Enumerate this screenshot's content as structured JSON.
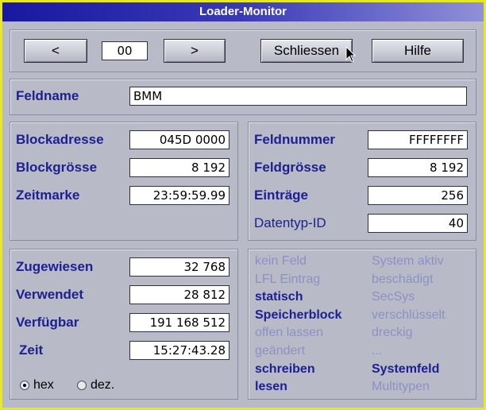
{
  "window": {
    "title": "Loader-Monitor"
  },
  "toolbar": {
    "prev_label": "<",
    "counter": "00",
    "next_label": ">",
    "close_label": "Schliessen",
    "help_label": "Hilfe"
  },
  "field_row": {
    "label": "Feldname",
    "value": "BMM"
  },
  "block": [
    {
      "label": "Blockadresse",
      "value": "045D 0000"
    },
    {
      "label": "Blockgrösse",
      "value": "8 192"
    },
    {
      "label": "Zeitmarke",
      "value": "23:59:59.99"
    }
  ],
  "field_info": [
    {
      "label": "Feldnummer",
      "value": "FFFFFFFF"
    },
    {
      "label": "Feldgrösse",
      "value": "8 192"
    },
    {
      "label": "Einträge",
      "value": "256"
    },
    {
      "label": "Datentyp-ID",
      "value": "40"
    }
  ],
  "memory": [
    {
      "label": "Zugewiesen",
      "value": "32 768"
    },
    {
      "label": "Verwendet",
      "value": "28 812"
    },
    {
      "label": "Verfügbar",
      "value": "191 168 512"
    },
    {
      "label": "Zeit",
      "value": "15:27:43.28"
    }
  ],
  "radix": {
    "hex_label": "hex",
    "dec_label": "dez.",
    "selected": "hex"
  },
  "status_left": [
    {
      "text": "kein Feld",
      "active": false
    },
    {
      "text": "LFL Eintrag",
      "active": false
    },
    {
      "text": "statisch",
      "active": true
    },
    {
      "text": "Speicherblock",
      "active": true
    },
    {
      "text": "offen lassen",
      "active": false
    },
    {
      "text": "geändert",
      "active": false
    },
    {
      "text": "schreiben",
      "active": true
    },
    {
      "text": "lesen",
      "active": true
    }
  ],
  "status_right": [
    {
      "text": "System aktiv",
      "active": false
    },
    {
      "text": "beschädigt",
      "active": false
    },
    {
      "text": "SecSys",
      "active": false
    },
    {
      "text": "verschlüsselt",
      "active": false
    },
    {
      "text": "dreckig",
      "active": false
    },
    {
      "text": "...",
      "active": false
    },
    {
      "text": "Systemfeld",
      "active": true
    },
    {
      "text": "Multitypen",
      "active": false
    }
  ],
  "colors": {
    "active": "#1c2090",
    "inactive": "#8e90c4",
    "window": "#b8bac8",
    "frame": "#e8e820"
  }
}
